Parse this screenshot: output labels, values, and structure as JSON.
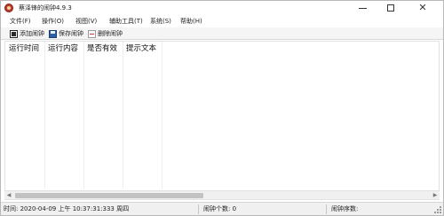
{
  "window": {
    "title": "蔡泽锋的闹钟4.9.3",
    "minimize_glyph": "—",
    "close_glyph": "✕"
  },
  "menu": {
    "items": [
      {
        "label": "文件(F)"
      },
      {
        "label": "操作(O)"
      },
      {
        "label": "视图(V)"
      },
      {
        "label": "辅助工具(T)"
      },
      {
        "label": "系统(S)"
      },
      {
        "label": "帮助(H)"
      }
    ]
  },
  "toolbar": {
    "add_label": "添加闹钟",
    "save_label": "保存闹钟",
    "delete_label": "删除闹钟"
  },
  "list": {
    "columns": [
      {
        "label": "运行时间"
      },
      {
        "label": "运行内容"
      },
      {
        "label": "是否有效"
      },
      {
        "label": "提示文本"
      }
    ],
    "rows": []
  },
  "scrollbar": {
    "left_glyph": "◀",
    "right_glyph": "▶"
  },
  "statusbar": {
    "time_text": "时间: 2020-04-09 上午 10:37:31:333  周四",
    "alarm_count_text": "闹钟个数: 0",
    "alarm_index_text": "闹钟序数:"
  },
  "icons": {
    "app": "alarm-clock-icon",
    "add": "add-alarm-icon",
    "save": "save-disk-icon",
    "delete": "delete-alarm-icon"
  }
}
